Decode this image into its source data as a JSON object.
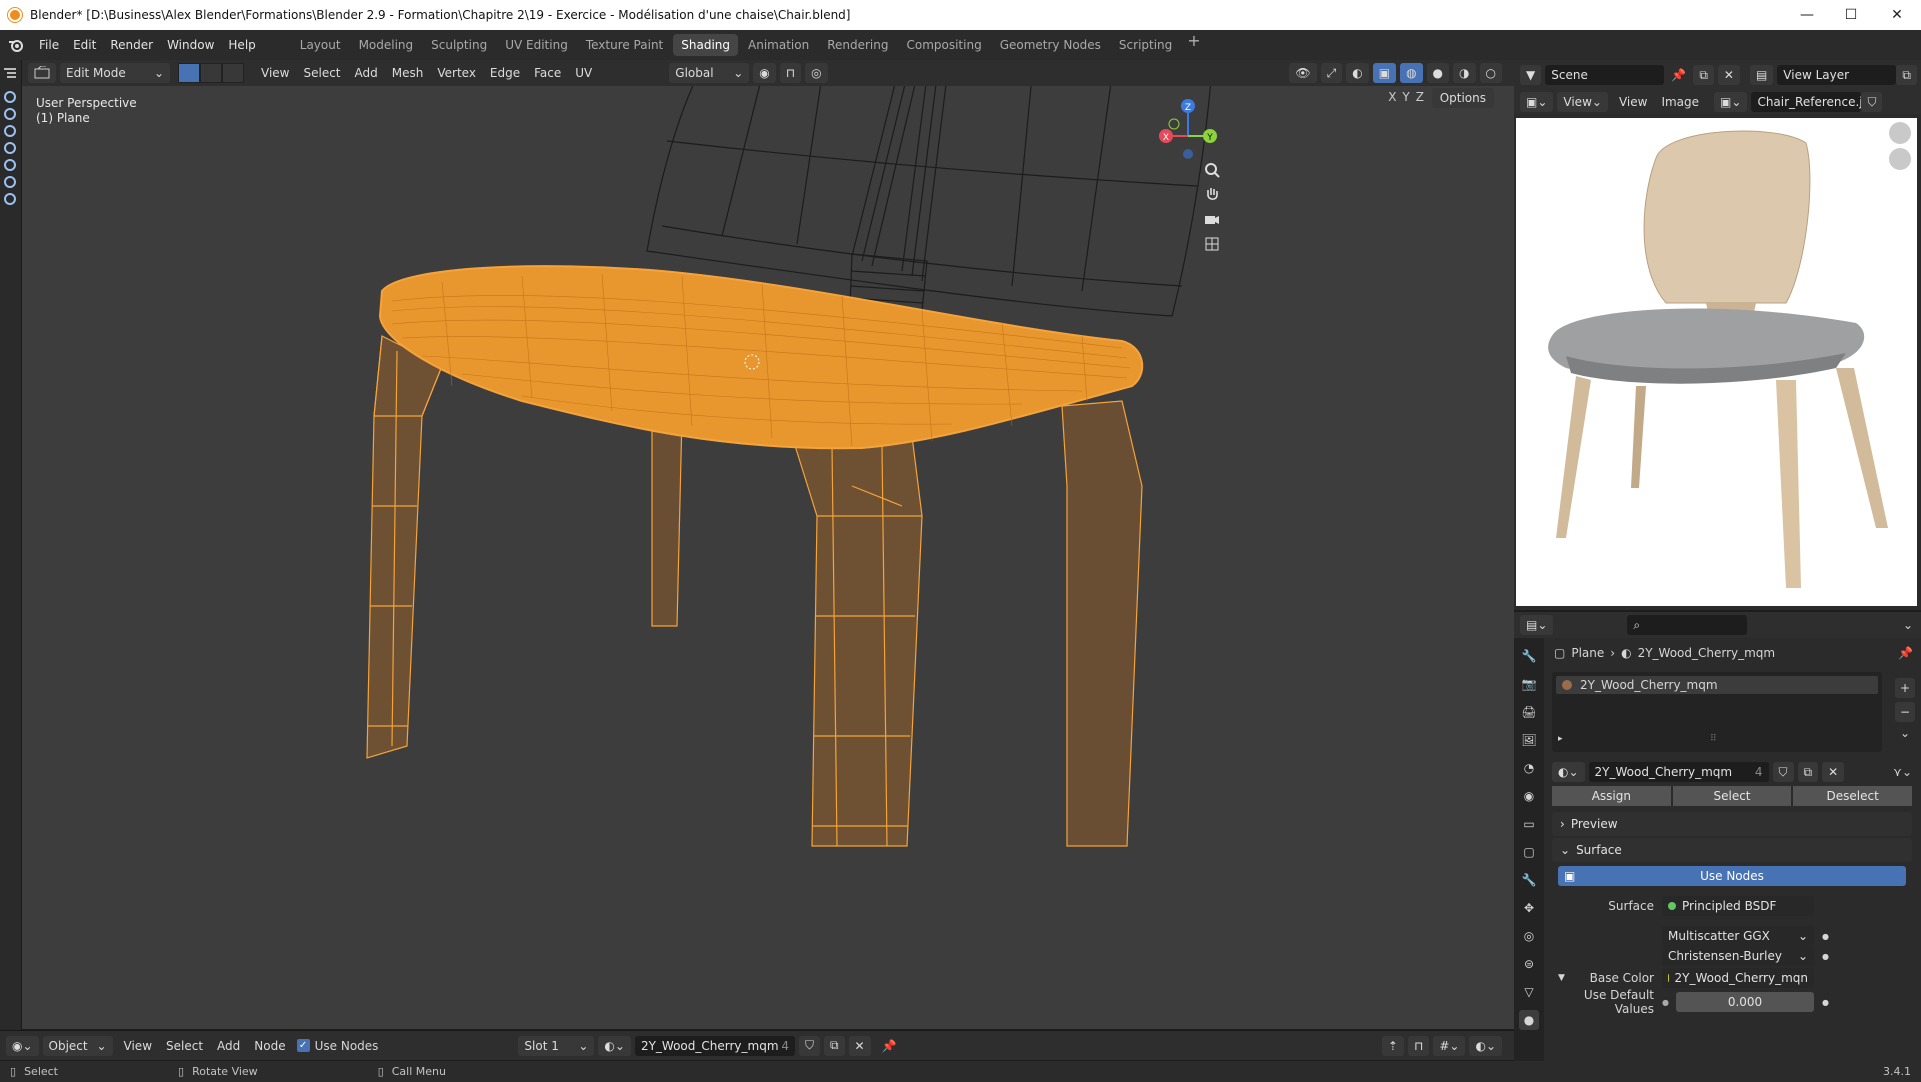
{
  "window": {
    "title": "Blender* [D:\\Business\\Alex Blender\\Formations\\Blender 2.9 - Formation\\Chapitre 2\\19 - Exercice - Modélisation d'une chaise\\Chair.blend]",
    "minimize": "—",
    "maximize": "☐",
    "close": "✕"
  },
  "menubar": {
    "items": [
      "File",
      "Edit",
      "Render",
      "Window",
      "Help"
    ]
  },
  "workspaces": {
    "tabs": [
      "Layout",
      "Modeling",
      "Sculpting",
      "UV Editing",
      "Texture Paint",
      "Shading",
      "Animation",
      "Rendering",
      "Compositing",
      "Geometry Nodes",
      "Scripting"
    ],
    "active": "Shading",
    "add": "+"
  },
  "viewport": {
    "mode": "Edit Mode",
    "menus": [
      "View",
      "Select",
      "Add",
      "Mesh",
      "Vertex",
      "Edge",
      "Face",
      "UV"
    ],
    "orientation": "Global",
    "perspective_label": "User Perspective",
    "object_label": "(1) Plane",
    "options": "Options",
    "axes": [
      "X",
      "Y",
      "Z"
    ],
    "gizmo": {
      "x": "X",
      "y": "Y",
      "z": "Z"
    },
    "colors": {
      "selection": "#f5a33a",
      "background": "#3d3d3d",
      "wire": "#1c1c1c"
    }
  },
  "right_header": {
    "scene": "Scene",
    "view_layer": "View Layer"
  },
  "image_editor": {
    "menus": [
      "View",
      "View",
      "Image"
    ],
    "image_name": "Chair_Reference.jpg"
  },
  "properties": {
    "breadcrumb_object": "Plane",
    "breadcrumb_material": "2Y_Wood_Cherry_mqm",
    "slot_name": "2Y_Wood_Cherry_mqm",
    "material_field": "2Y_Wood_Cherry_mqm",
    "material_users": "4",
    "assign": "Assign",
    "select": "Select",
    "deselect": "Deselect",
    "preview": "Preview",
    "surface": "Surface",
    "use_nodes": "Use Nodes",
    "surface_label": "Surface",
    "surface_value": "Principled BSDF",
    "distribution": "Multiscatter GGX",
    "subsurface": "Christensen-Burley",
    "base_color_label": "Base Color",
    "base_color_value": "2Y_Wood_Cherry_mqn",
    "use_default_label": "Use Default Values",
    "use_default_value": "0.000",
    "search_icon": "search-icon"
  },
  "node_editor": {
    "mode": "Object",
    "menus": [
      "View",
      "Select",
      "Add",
      "Node"
    ],
    "use_nodes": "Use Nodes",
    "slot": "Slot 1",
    "material": "2Y_Wood_Cherry_mqm",
    "users": "4"
  },
  "statusbar": {
    "select": "Select",
    "rotate": "Rotate View",
    "call_menu": "Call Menu",
    "version": "3.4.1"
  }
}
